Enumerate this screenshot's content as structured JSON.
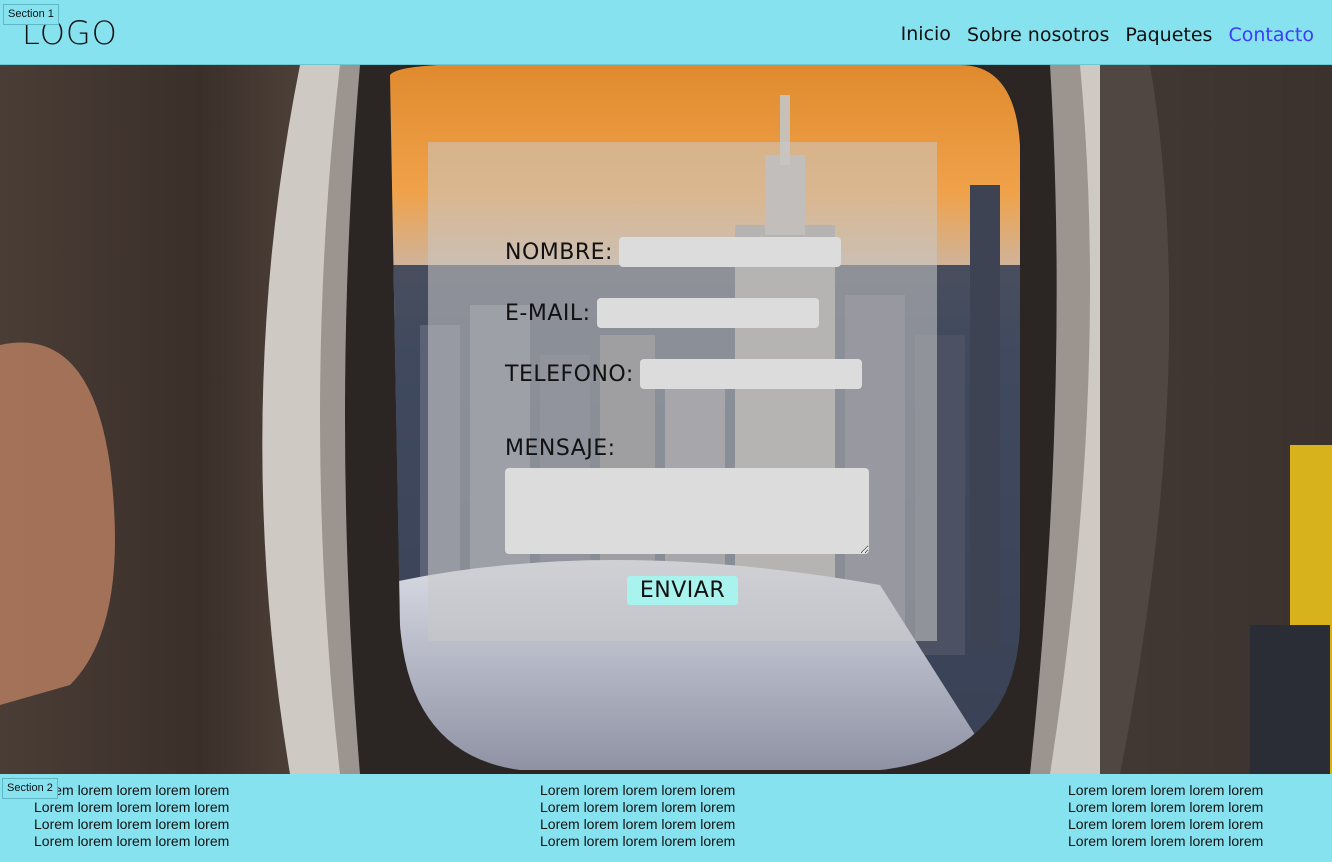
{
  "header": {
    "section_tag": "Section 1",
    "logo": "LOGO",
    "nav": [
      "Inicio",
      "Sobre nosotros",
      "Paquetes",
      "Contacto"
    ],
    "active_nav": "Contacto"
  },
  "form": {
    "nombre_label": "NOMBRE:",
    "email_label": "E-MAIL:",
    "telefono_label": "TELEFONO:",
    "mensaje_label": "MENSAJE:",
    "submit_label": "ENVIAR",
    "nombre_value": "",
    "email_value": "",
    "telefono_value": "",
    "mensaje_value": ""
  },
  "footer": {
    "section_tag": "Section 2",
    "columns": [
      [
        "Lorem lorem lorem lorem lorem",
        "Lorem lorem lorem lorem lorem",
        "Lorem lorem lorem lorem lorem",
        "Lorem lorem lorem lorem lorem"
      ],
      [
        "Lorem lorem lorem lorem lorem",
        "Lorem lorem lorem lorem lorem",
        "Lorem lorem lorem lorem lorem",
        "Lorem lorem lorem lorem lorem"
      ],
      [
        "Lorem lorem lorem lorem lorem",
        "Lorem lorem lorem lorem lorem",
        "Lorem lorem lorem lorem lorem",
        "Lorem lorem lorem lorem lorem"
      ]
    ]
  },
  "colors": {
    "header_bg": "#87e2ef",
    "nav_active": "#3b3bff",
    "panel_bg": "rgba(200,200,200,0.55)",
    "field_bg": "#dcdcdc",
    "button_bg": "#a9f3ee"
  }
}
